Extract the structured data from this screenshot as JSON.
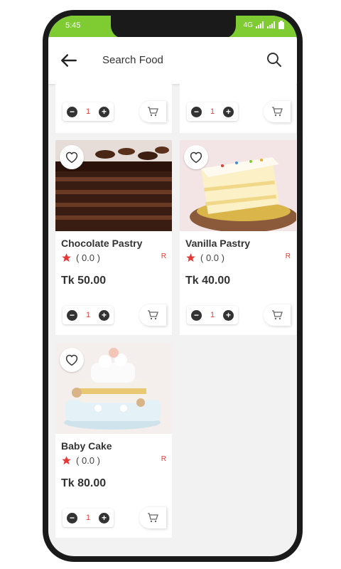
{
  "status": {
    "time": "5:45",
    "network": "4G"
  },
  "appbar": {
    "title": "Search Food"
  },
  "top_partial": [
    {
      "qty": "1"
    },
    {
      "qty": "1"
    }
  ],
  "products": [
    {
      "name": "Chocolate Pastry",
      "rating": "( 0.0 )",
      "tag": "R",
      "price": "Tk 50.00",
      "qty": "1"
    },
    {
      "name": "Vanilla Pastry",
      "rating": "( 0.0 )",
      "tag": "R",
      "price": "Tk 40.00",
      "qty": "1"
    },
    {
      "name": "Baby Cake",
      "rating": "( 0.0 )",
      "tag": "R",
      "price": "Tk 80.00",
      "qty": "1"
    }
  ],
  "colors": {
    "accent": "#7ecb32",
    "star": "#e53935",
    "price_tag": "#e53935"
  }
}
